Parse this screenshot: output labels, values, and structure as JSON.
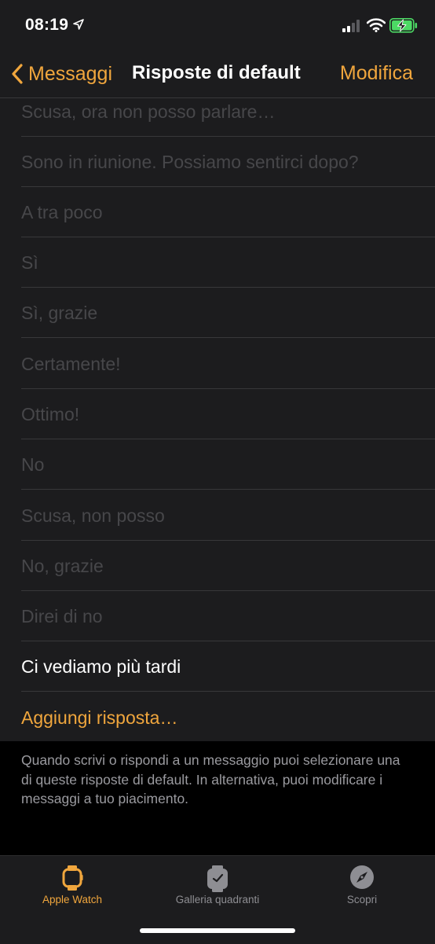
{
  "status_bar": {
    "time": "08:19"
  },
  "nav": {
    "back_label": "Messaggi",
    "title": "Risposte di default",
    "edit_label": "Modifica"
  },
  "responses": [
    {
      "label": "Scusa, ora non posso parlare…"
    },
    {
      "label": "Sono in riunione. Possiamo sentirci dopo?"
    },
    {
      "label": "A tra poco"
    },
    {
      "label": "Sì"
    },
    {
      "label": "Sì, grazie"
    },
    {
      "label": "Certamente!"
    },
    {
      "label": "Ottimo!"
    },
    {
      "label": "No"
    },
    {
      "label": "Scusa, non posso"
    },
    {
      "label": "No, grazie"
    },
    {
      "label": "Direi di no"
    },
    {
      "label": "Ci vediamo più tardi"
    }
  ],
  "add_response_label": "Aggiungi risposta…",
  "footer_note": "Quando scrivi o rispondi a un messaggio puoi selezionare una di queste risposte di default. In alternativa, puoi modificare i messaggi a tuo piacimento.",
  "tabs": [
    {
      "label": "Apple Watch",
      "active": true
    },
    {
      "label": "Galleria quadranti",
      "active": false
    },
    {
      "label": "Scopri",
      "active": false
    }
  ],
  "colors": {
    "accent": "#f0a63d",
    "inactive_tab": "#8e8e93",
    "battery": "#4cd964"
  }
}
